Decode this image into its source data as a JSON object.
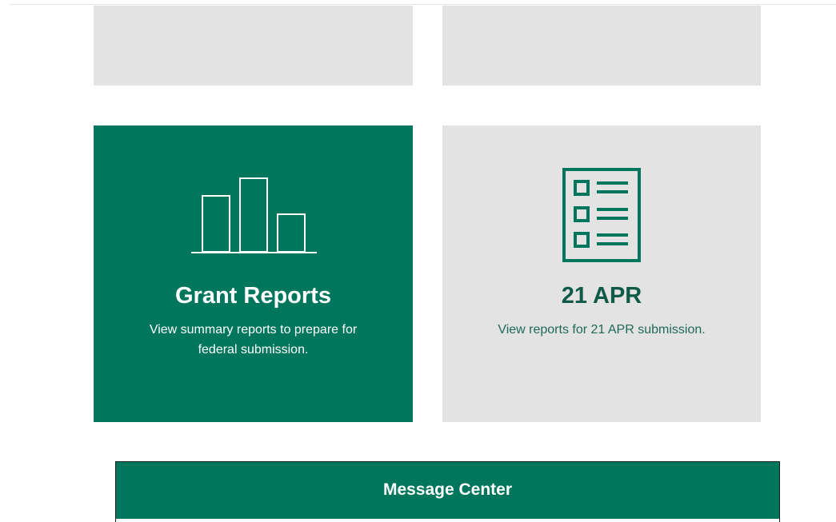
{
  "tiles": {
    "grant_reports": {
      "title": "Grant Reports",
      "description": "View summary reports to prepare for federal submission.",
      "icon": "bar-chart-icon",
      "background": "#00775d",
      "text_color": "#ffffff"
    },
    "apr": {
      "title": "21 APR",
      "description": "View reports for 21 APR submission.",
      "icon": "checklist-icon",
      "background": "#e3e3e3",
      "text_color": "#0f5a47"
    },
    "top_left": {
      "background": "#e3e3e3"
    },
    "top_right": {
      "background": "#e3e3e3"
    }
  },
  "message_center": {
    "title": "Message Center",
    "background": "#00775d"
  },
  "colors": {
    "accent": "#00775d",
    "tile_grey": "#e3e3e3",
    "page_background": "#ffffff"
  }
}
